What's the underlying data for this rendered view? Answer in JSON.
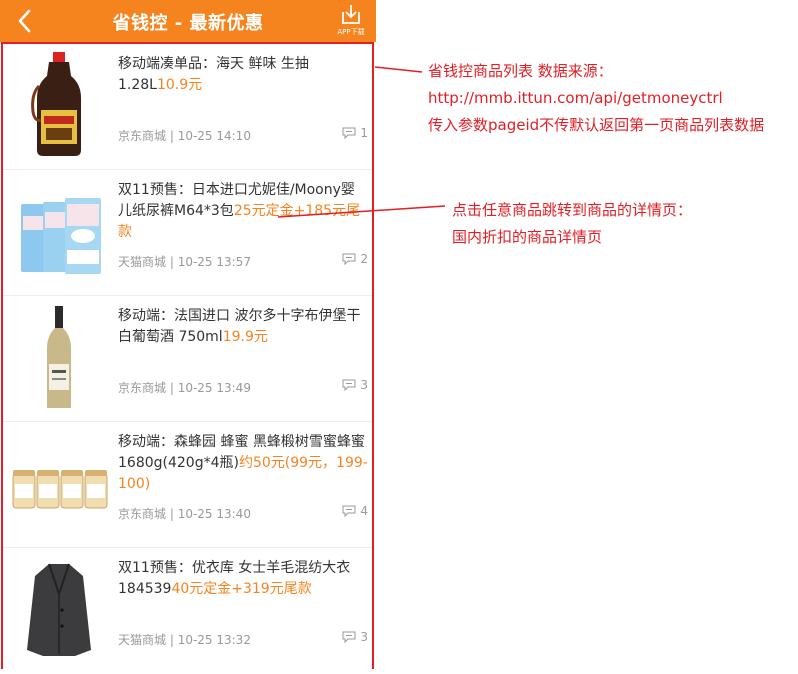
{
  "header": {
    "title": "省钱控 - 最新优惠",
    "app_download": "APP下载"
  },
  "items": [
    {
      "title": "移动端凑单品：海天 鲜味 生抽1.28L",
      "price": "10.9元",
      "source": "京东商城",
      "time": "10-25 14:10",
      "comments": "1",
      "image": "soy-sauce-bottle"
    },
    {
      "title": "双11预售：日本进口尤妮佳/Moony婴儿纸尿裤M64*3包",
      "price": "25元定金+185元尾款",
      "source": "天猫商城",
      "time": "10-25 13:57",
      "comments": "2",
      "image": "diaper-packs"
    },
    {
      "title": "移动端：法国进口 波尔多十字布伊堡干白葡萄酒 750ml",
      "price": "19.9元",
      "source": "京东商城",
      "time": "10-25 13:49",
      "comments": "3",
      "image": "wine-bottle"
    },
    {
      "title": "移动端：森蜂园 蜂蜜 黑蜂椴树雪蜜蜂蜜1680g(420g*4瓶)",
      "price": "约50元(99元，199-100)",
      "source": "京东商城",
      "time": "10-25 13:40",
      "comments": "4",
      "image": "honey-jars"
    },
    {
      "title": "双11预售：优衣库 女士羊毛混纺大衣184539",
      "price": "40元定金+319元尾款",
      "source": "天猫商城",
      "time": "10-25 13:32",
      "comments": "3",
      "image": "wool-coat"
    }
  ],
  "annotations": {
    "list_note": [
      "省钱控商品列表 数据来源：",
      "http://mmb.ittun.com/api/getmoneyctrl",
      "传入参数pageid不传默认返回第一页商品列表数据"
    ],
    "detail_note": [
      "点击任意商品跳转到商品的详情页：",
      "国内折扣的商品详情页"
    ]
  },
  "colors": {
    "header": "#f5841f",
    "price": "#f5841f",
    "annotation": "#e31e24",
    "frame": "#e31e24"
  }
}
